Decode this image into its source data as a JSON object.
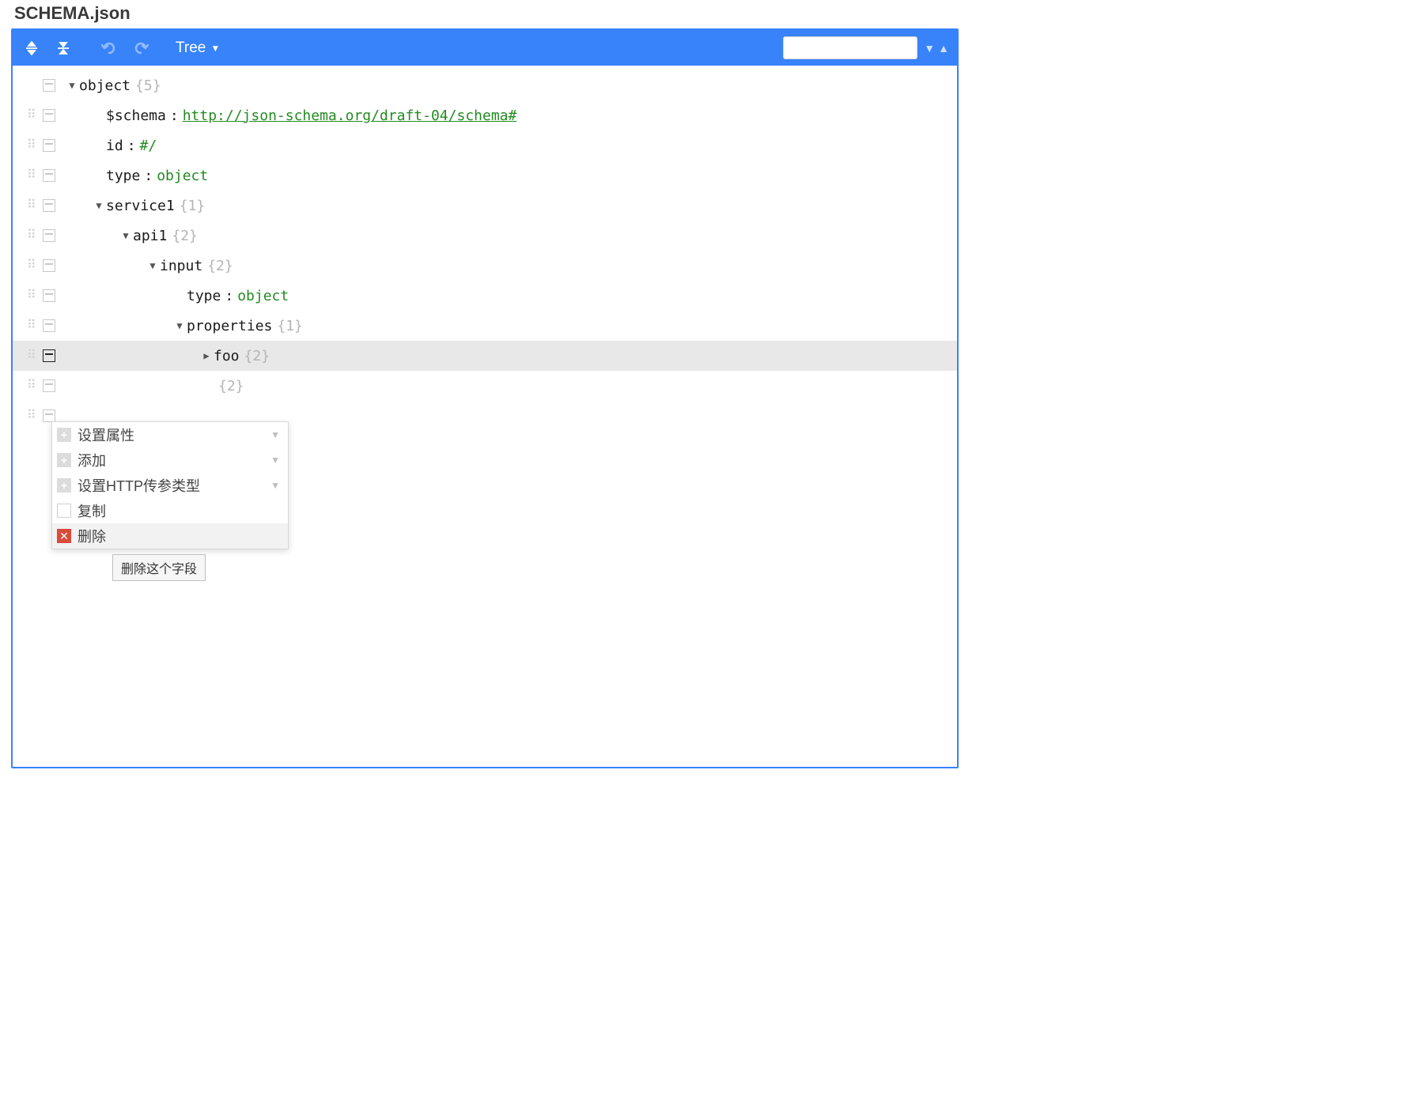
{
  "title": "SCHEMA.json",
  "toolbar": {
    "view_mode": "Tree"
  },
  "search": {
    "placeholder": ""
  },
  "tree": {
    "rows": [
      {
        "indent": 0,
        "expand": "down",
        "key": "object",
        "count": "{5}",
        "drag": false
      },
      {
        "indent": 1,
        "expand": "",
        "key": "$schema",
        "colon": true,
        "val": "http://json-schema.org/draft-04/schema#",
        "valType": "link",
        "drag": true
      },
      {
        "indent": 1,
        "expand": "",
        "key": "id",
        "colon": true,
        "val": "#/",
        "valType": "str",
        "drag": true
      },
      {
        "indent": 1,
        "expand": "",
        "key": "type",
        "colon": true,
        "val": "object",
        "valType": "kw",
        "drag": true
      },
      {
        "indent": 1,
        "expand": "down",
        "key": "service1",
        "count": "{1}",
        "drag": true
      },
      {
        "indent": 2,
        "expand": "down",
        "key": "api1",
        "count": "{2}",
        "drag": true
      },
      {
        "indent": 3,
        "expand": "down",
        "key": "input",
        "count": "{2}",
        "drag": true
      },
      {
        "indent": 4,
        "expand": "",
        "key": "type",
        "colon": true,
        "val": "object",
        "valType": "kw",
        "drag": true
      },
      {
        "indent": 4,
        "expand": "down",
        "key": "properties",
        "count": "{1}",
        "drag": true
      },
      {
        "indent": 5,
        "expand": "right",
        "key": "foo",
        "count": "{2}",
        "drag": true,
        "selected": true
      },
      {
        "indent": 5,
        "expand": "",
        "partial_count": "{2}",
        "drag": true
      },
      {
        "indent": 0,
        "expand": "",
        "drag": true,
        "empty": true
      }
    ]
  },
  "context_menu": {
    "items": [
      {
        "icon": "plus",
        "label": "设置属性",
        "submenu": true
      },
      {
        "icon": "plus",
        "label": "添加",
        "submenu": true
      },
      {
        "icon": "plus",
        "label": "设置HTTP传参类型",
        "submenu": true
      },
      {
        "icon": "copy",
        "label": "复制"
      },
      {
        "icon": "del",
        "label": "删除",
        "selected": true
      }
    ]
  },
  "tooltip": "删除这个字段"
}
